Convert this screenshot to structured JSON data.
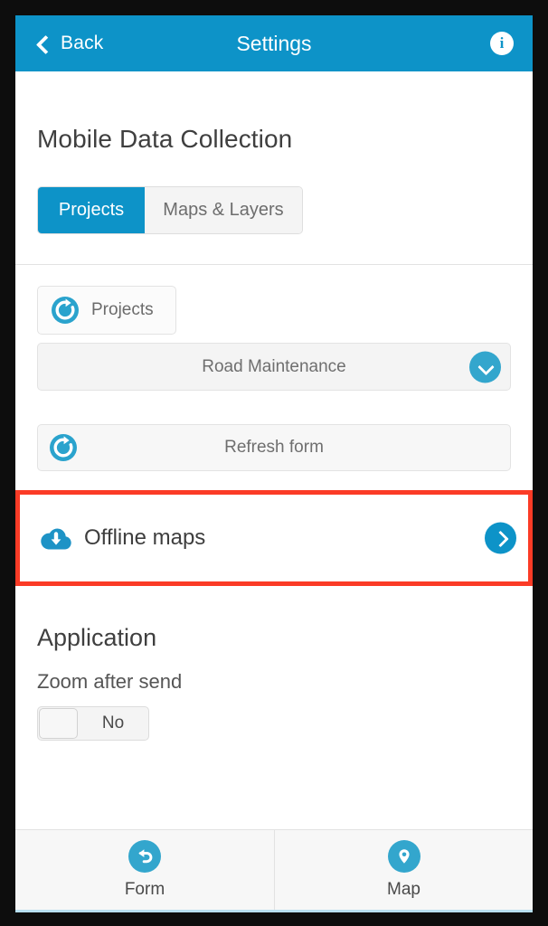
{
  "appbar": {
    "back_label": "Back",
    "title": "Settings",
    "info_glyph": "i",
    "back_icon": "chevron-left-icon",
    "info_icon": "info-icon",
    "background_color": "#0d93c8"
  },
  "page": {
    "title": "Mobile Data Collection",
    "accent_color": "#0d93c8",
    "highlight_color": "#fb3b26"
  },
  "tabs": [
    {
      "label": "Projects",
      "active": true
    },
    {
      "label": "Maps & Layers",
      "active": false
    }
  ],
  "projects_section": {
    "refresh_projects_label": "Projects",
    "refresh_projects_icon": "refresh-icon",
    "selected_project": "Road Maintenance",
    "select_chevron_icon": "chevron-down-icon",
    "refresh_form_label": "Refresh form",
    "refresh_form_icon": "refresh-icon"
  },
  "offline_maps": {
    "label": "Offline maps",
    "icon": "cloud-download-icon",
    "chevron_icon": "chevron-right-icon",
    "highlighted": true
  },
  "application_section": {
    "heading": "Application",
    "zoom_after_send_label": "Zoom after send",
    "zoom_after_send_value": "No"
  },
  "bottom_bar": {
    "tabs": [
      {
        "label": "Form",
        "icon": "undo-arrow-icon"
      },
      {
        "label": "Map",
        "icon": "map-pin-icon"
      }
    ]
  }
}
